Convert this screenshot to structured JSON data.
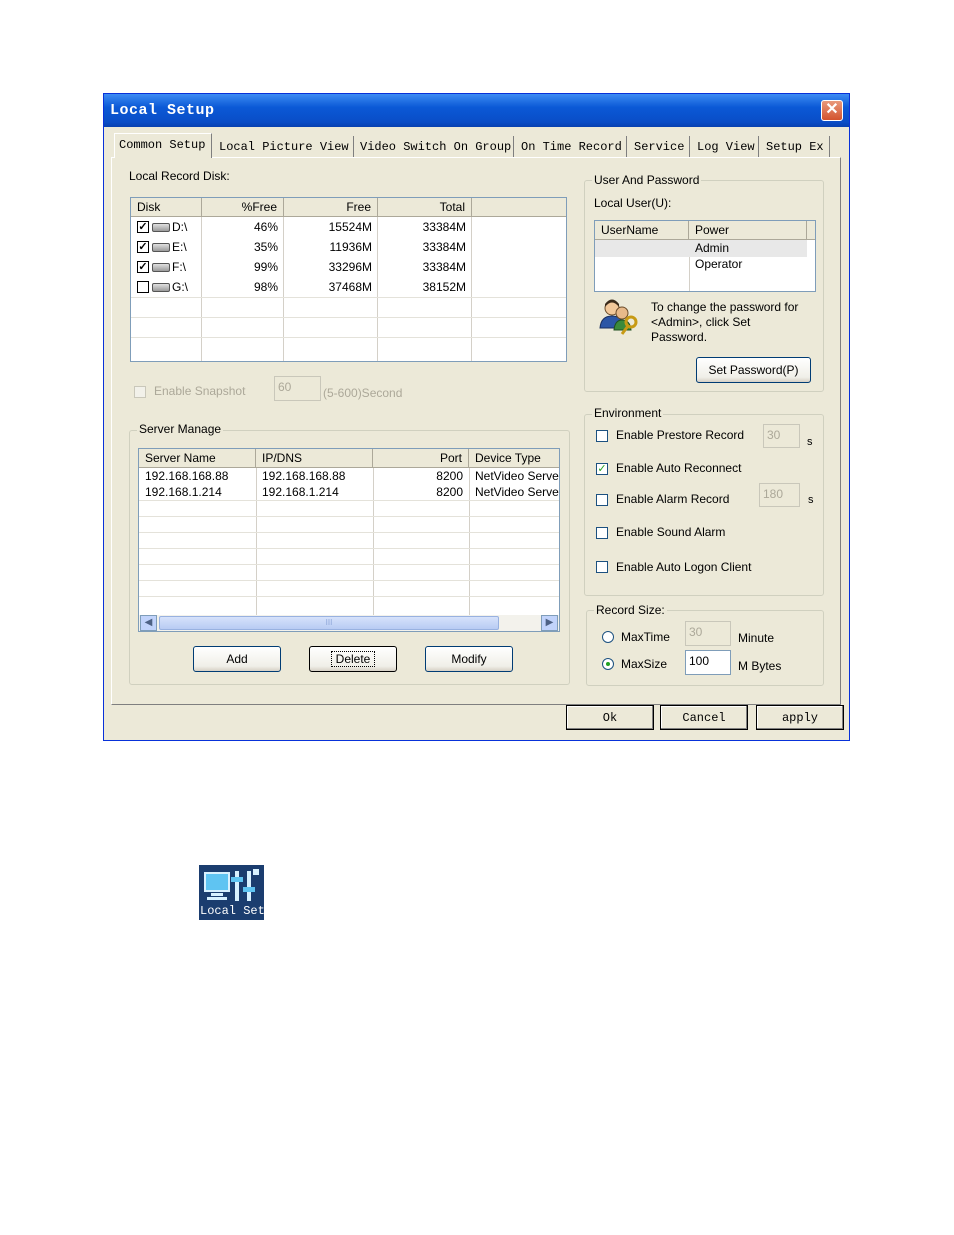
{
  "window": {
    "title": "Local Setup",
    "close_glyph": "✕",
    "tabs": [
      "Common Setup",
      "Local Picture View",
      "Video Switch On Group",
      "On Time Record",
      "Service",
      "Log View",
      "Setup Ex"
    ],
    "active_tab": "Common Setup"
  },
  "record_disk": {
    "label": "Local Record Disk:",
    "columns": [
      "Disk",
      "%Free",
      "Free",
      "Total"
    ],
    "rows": [
      {
        "checked": true,
        "disk": "D:\\",
        "pct_free": "46%",
        "free": "15524M",
        "total": "33384M"
      },
      {
        "checked": true,
        "disk": "E:\\",
        "pct_free": "35%",
        "free": "11936M",
        "total": "33384M"
      },
      {
        "checked": true,
        "disk": "F:\\",
        "pct_free": "99%",
        "free": "33296M",
        "total": "33384M"
      },
      {
        "checked": false,
        "disk": "G:\\",
        "pct_free": "98%",
        "free": "37468M",
        "total": "38152M"
      }
    ]
  },
  "snapshot": {
    "label": "Enable Snapshot",
    "value": "60",
    "range_text": "(5-600)Second"
  },
  "server_manage": {
    "label": "Server Manage",
    "columns": [
      "Server Name",
      "IP/DNS",
      "Port",
      "Device Type"
    ],
    "rows": [
      {
        "name": "192.168.168.88",
        "ip": "192.168.168.88",
        "port": "8200",
        "type": "NetVideo Serve"
      },
      {
        "name": "192.168.1.214",
        "ip": "192.168.1.214",
        "port": "8200",
        "type": "NetVideo Serve"
      }
    ],
    "scroll_thumb_glyph": "III",
    "buttons": {
      "add": "Add",
      "delete": "Delete",
      "modify": "Modify"
    }
  },
  "user_password": {
    "label": "User And Password",
    "local_user_label": "Local User(U):",
    "columns": [
      "UserName",
      "Power"
    ],
    "rows": [
      {
        "username": "",
        "power": "Admin"
      },
      {
        "username": "",
        "power": "Operator"
      }
    ],
    "hint": [
      "To change the password for",
      "<Admin>, click Set",
      "Password."
    ],
    "set_password_button": "Set Password(P)",
    "icon": "users-key-icon"
  },
  "environment": {
    "label": "Environment",
    "prestore": {
      "label": "Enable Prestore Record",
      "checked": false,
      "value": "30",
      "unit": "s"
    },
    "auto_reconnect": {
      "label": "Enable Auto Reconnect",
      "checked": true
    },
    "alarm_record": {
      "label": "Enable Alarm Record",
      "checked": false,
      "value": "180",
      "unit": "s"
    },
    "sound_alarm": {
      "label": "Enable Sound Alarm",
      "checked": false
    },
    "auto_logon": {
      "label": "Enable Auto Logon Client",
      "checked": false
    }
  },
  "record_size": {
    "label": "Record Size:",
    "max_time": {
      "label": "MaxTime",
      "value": "30",
      "unit": "Minute",
      "selected": false
    },
    "max_size": {
      "label": "MaxSize",
      "value": "100",
      "unit": "M Bytes",
      "selected": true
    }
  },
  "dialog_buttons": {
    "ok": "Ok",
    "cancel": "Cancel",
    "apply": "apply"
  },
  "desktop_icon": {
    "label": "Local Set",
    "icon": "local-setup-icon"
  },
  "colors": {
    "titlebar": "#0a4dc7",
    "close": "#d3522e",
    "dialog_bg": "#ece9d8",
    "check": "#21a121"
  }
}
